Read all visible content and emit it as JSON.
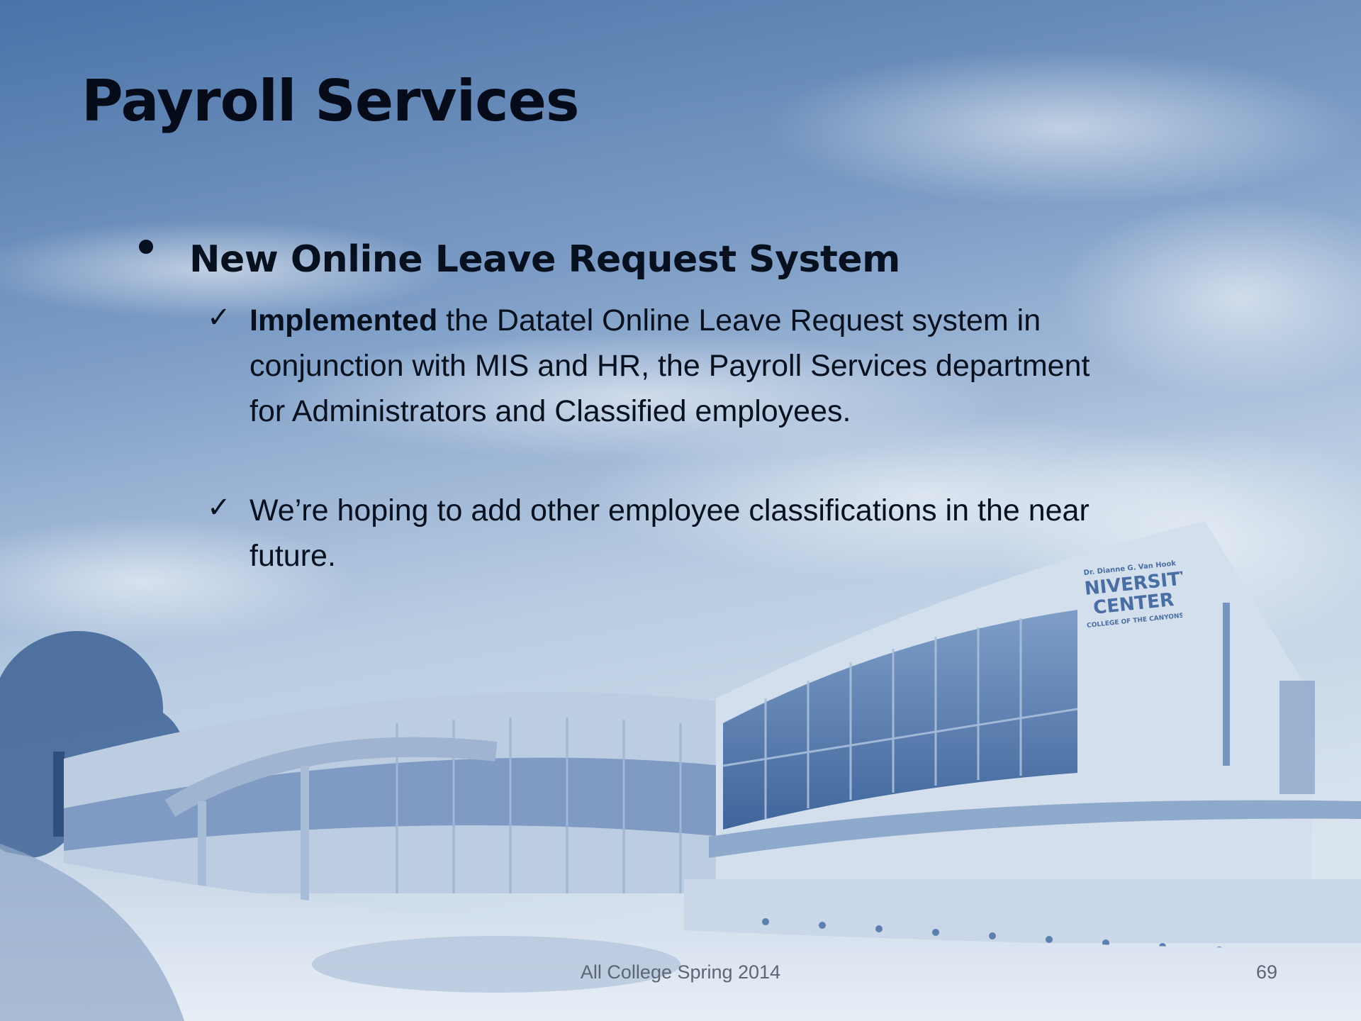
{
  "slide": {
    "title": "Payroll Services",
    "bullet": {
      "heading": "New Online Leave Request System",
      "items": [
        {
          "bold": "Implemented",
          "text": " the Datatel Online Leave Request system in conjunction with MIS and HR, the Payroll Services department for Administrators and Classified employees."
        },
        {
          "bold": "",
          "text": "We’re hoping to add other employee classifications in the near future."
        }
      ]
    },
    "building_sign": {
      "line1": "Dr. Dianne G. Van Hook",
      "line2": "UNIVERSITY",
      "line3": "CENTER",
      "line4": "COLLEGE OF THE CANYONS"
    },
    "footer": "All College Spring 2014",
    "page_number": "69"
  },
  "colors": {
    "sky_top": "#4a73a8",
    "sky_light": "#d6e2ee",
    "text": "#06101f",
    "footer_text": "#5d6676"
  },
  "icons": {
    "bullet": "filled-circle",
    "check": "check-mark"
  }
}
